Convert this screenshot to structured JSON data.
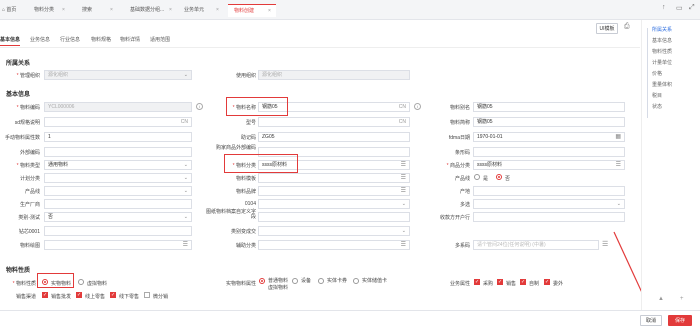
{
  "tabs": [
    {
      "label": "首页"
    },
    {
      "label": "物料分类"
    },
    {
      "label": "搜索"
    },
    {
      "label": "基础数据分组..."
    },
    {
      "label": "业务单元"
    },
    {
      "label": "物料创建"
    }
  ],
  "top_btn": "UI模板",
  "subtabs": [
    "基本信息",
    "业务信息",
    "行业信息",
    "物料规格",
    "物料详情",
    "适用范围"
  ],
  "sections": {
    "org": "所属关系",
    "basic": "基本信息",
    "props": "物料性质"
  },
  "fields": {
    "mgmt_org": {
      "label": "管理组织",
      "placeholder": "源化组织"
    },
    "use_org": {
      "label": "使用组织",
      "placeholder": "源化组织"
    },
    "code": {
      "label": "物料编码",
      "value": "YCL000006"
    },
    "name": {
      "label": "物料名称",
      "value": "钢筋05",
      "suffix": "CN"
    },
    "alias": {
      "label": "物料别名",
      "value": "钢筋05"
    },
    "sm_desc": {
      "label": "sd规格说明",
      "suffix": "CN"
    },
    "model": {
      "label": "型号",
      "suffix": "CN"
    },
    "short": {
      "label": "物料简称",
      "value": "钢筋05"
    },
    "attr_count": {
      "label": "手动物料属性数",
      "value": "1"
    },
    "barcode": {
      "label": "助记码",
      "value": "ZG05"
    },
    "date": {
      "label": "fdma日期",
      "value": "1970-01-01"
    },
    "ext_code": {
      "label": "外部编码"
    },
    "buyer_code": {
      "label": "购家商品外部编码"
    },
    "barcode2": {
      "label": "条形码"
    },
    "type": {
      "label": "物料类型",
      "value": "通用物料"
    },
    "category": {
      "label": "物料分类",
      "value": "ssss原材料"
    },
    "goods_cat": {
      "label": "商品分类",
      "value": "ssss原材料"
    },
    "plan": {
      "label": "计划分类"
    },
    "template": {
      "label": "物料模板"
    },
    "product_line": {
      "label": "产品线"
    },
    "product": {
      "label": "产品线"
    },
    "brand": {
      "label": "物料品牌"
    },
    "origin": {
      "label": "产地"
    },
    "maker": {
      "label": "生产厂商"
    },
    "num0104": {
      "label": "0104"
    },
    "multi": {
      "label": "多选"
    },
    "test": {
      "label": "类别-测试",
      "value": "否"
    },
    "custom": {
      "label": "图纸物料档案自定义字段"
    },
    "income": {
      "label": "收款方开户行"
    },
    "s001": {
      "label": "钻芯0001"
    },
    "cat2": {
      "label": "类别变成交"
    },
    "dwg": {
      "label": "物料绘图"
    },
    "aux": {
      "label": "辅助分类"
    },
    "multi_text": {
      "label": "多系码",
      "placeholder": "请个管间24位(任何说明) (中暑)"
    }
  },
  "product_radio": {
    "yes": "是",
    "no": "否"
  },
  "props": {
    "type_label": "物料性质",
    "type_options": [
      "实物物料",
      "虚拟物料"
    ],
    "attr_label": "实物物料属性",
    "attr_options": [
      "普通物料",
      "设备",
      "实体卡券",
      "实体储值卡",
      "虚拟物料"
    ],
    "biz_label": "业务属性",
    "biz_options": [
      "采购",
      "销售",
      "自制",
      "委外"
    ],
    "channel_label": "销售渠道",
    "channel_options": [
      "销售批发",
      "线上零售",
      "线下零售",
      "微分销"
    ]
  },
  "right_nav": [
    "所属关系",
    "基本信息",
    "物料性质",
    "计量单位",
    "价格",
    "重量体积",
    "税目",
    "状态"
  ],
  "footer": {
    "cancel": "取消",
    "save": "保存"
  }
}
